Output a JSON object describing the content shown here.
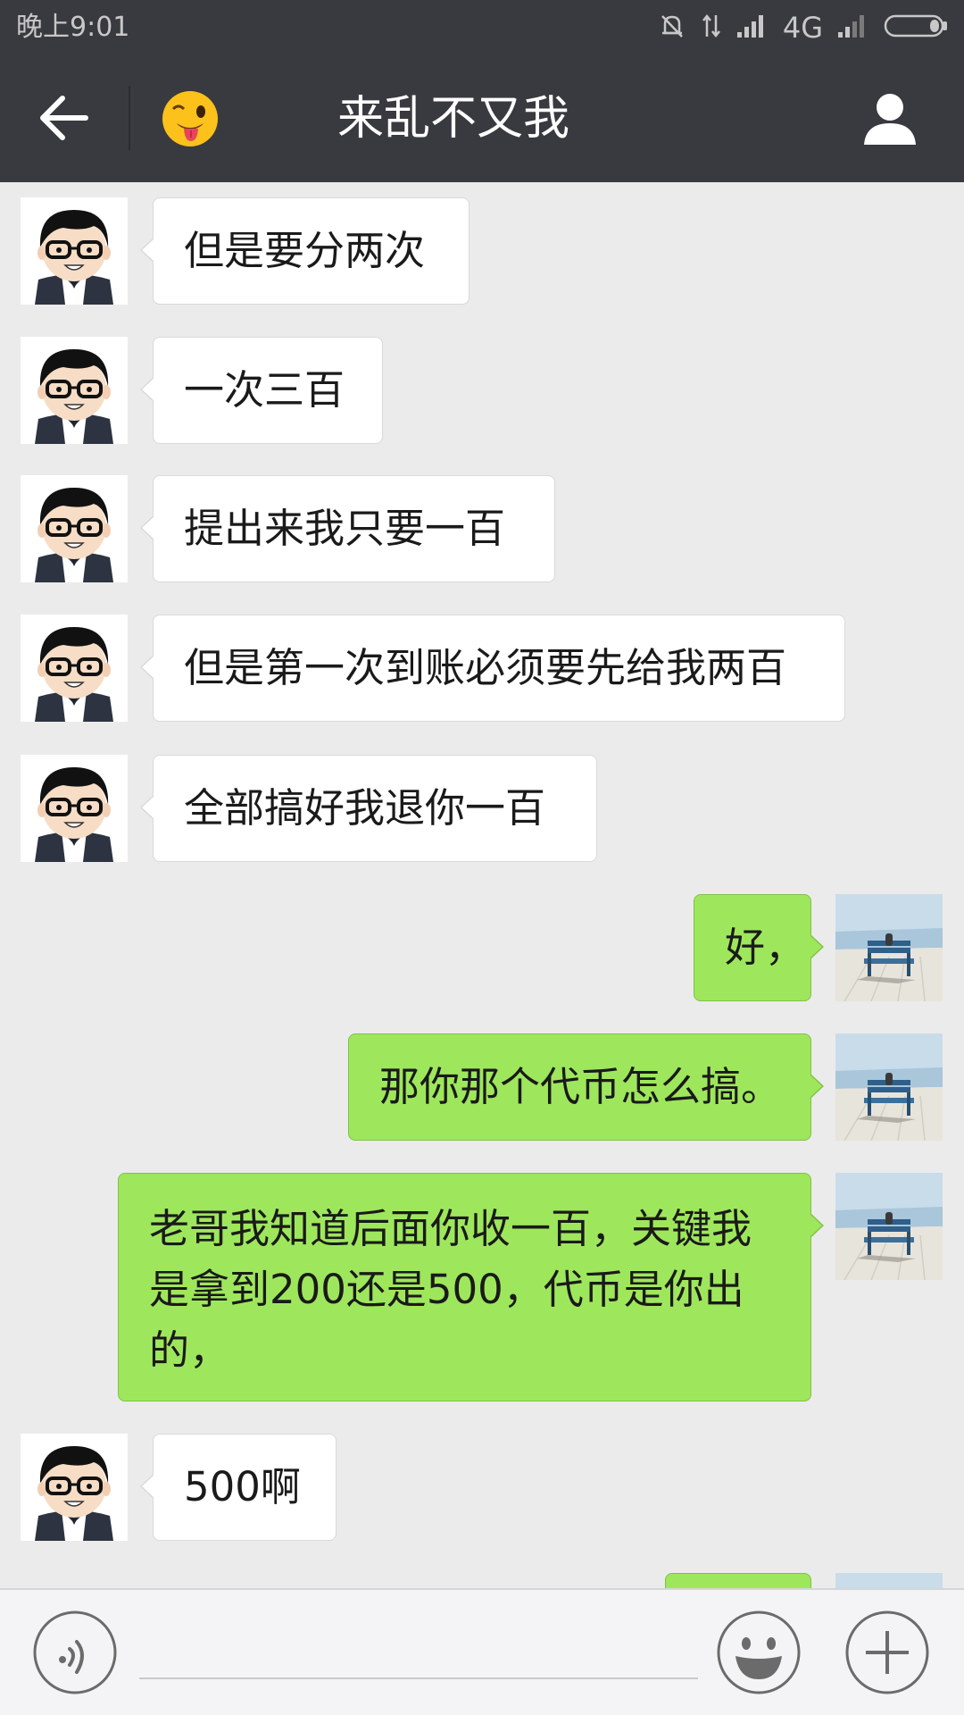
{
  "status_bar": {
    "time": "晚上9:01",
    "network": "4G"
  },
  "nav": {
    "title": "来乱不又我",
    "back_icon": "arrow-left-icon",
    "emoji_icon": "winking-tongue-emoji-icon",
    "profile_icon": "person-icon"
  },
  "messages": [
    {
      "direction": "in",
      "text": "但是要分两次"
    },
    {
      "direction": "in",
      "text": "一次三百"
    },
    {
      "direction": "in",
      "text": "提出来我只要一百"
    },
    {
      "direction": "in",
      "text": "但是第一次到账必须要先给我两百"
    },
    {
      "direction": "in",
      "text": "全部搞好我退你一百"
    },
    {
      "direction": "out",
      "text": "好，"
    },
    {
      "direction": "out",
      "text": "那你那个代币怎么搞。"
    },
    {
      "direction": "out",
      "text": "老哥我知道后面你收一百，关键我是拿到200还是500，代币是你出的，"
    },
    {
      "direction": "in",
      "text": "500啊"
    },
    {
      "direction": "out",
      "text": ""
    }
  ],
  "input": {
    "value": "",
    "voice_icon": "voice-icon",
    "emoji_icon": "smiley-icon",
    "plus_icon": "plus-icon"
  },
  "colors": {
    "header_bg": "#393a3f",
    "chat_bg": "#ebebeb",
    "bubble_in": "#ffffff",
    "bubble_out": "#9ee75c"
  }
}
